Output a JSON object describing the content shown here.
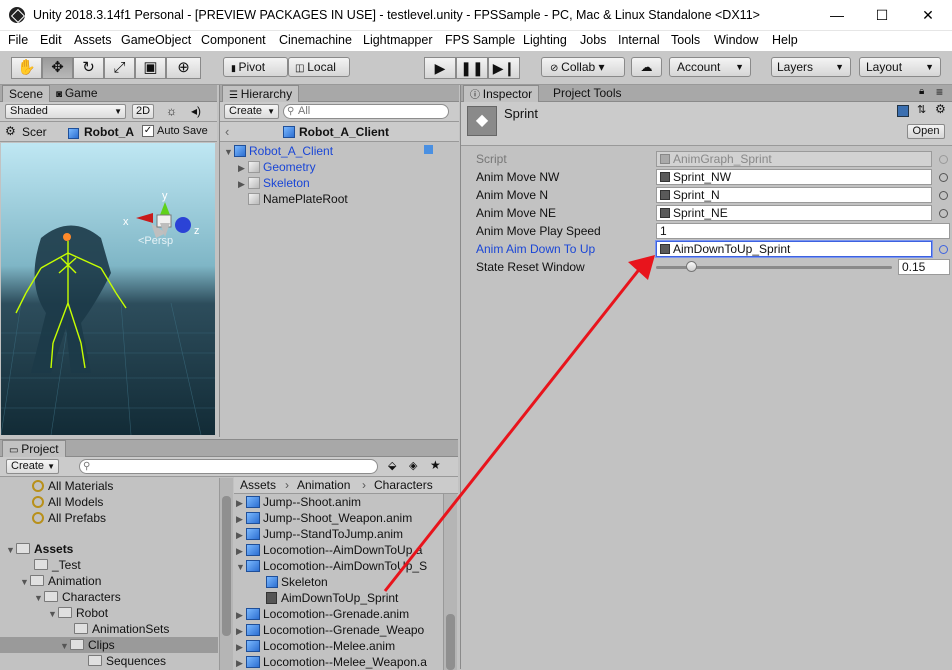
{
  "window": {
    "title": "Unity 2018.3.14f1 Personal - [PREVIEW PACKAGES IN USE] - testlevel.unity - FPSSample - PC, Mac & Linux Standalone <DX11>"
  },
  "menu": [
    "File",
    "Edit",
    "Assets",
    "GameObject",
    "Component",
    "Cinemachine",
    "Lightmapper",
    "FPS Sample",
    "Lighting",
    "Jobs",
    "Internal",
    "Tools",
    "Window",
    "Help"
  ],
  "toolbar": {
    "pivot": "Pivot",
    "local": "Local",
    "collab": "Collab ▾",
    "account": "Account",
    "layers": "Layers",
    "layout": "Layout"
  },
  "scene": {
    "tab_scene": "Scene",
    "tab_game": "Game",
    "shading": "Shaded",
    "mode_2d": "2D",
    "breadcrumb_scene": "Scer",
    "breadcrumb_object": "Robot_A",
    "auto_save": "Auto Save",
    "persp": "<Persp",
    "gizmo": {
      "y": "y",
      "x": "x",
      "z": "z"
    }
  },
  "hierarchy": {
    "tab": "Hierarchy",
    "create": "Create",
    "search_placeholder": "All",
    "header": "Robot_A_Client",
    "items": [
      {
        "label": "Robot_A_Client"
      },
      {
        "label": "Geometry"
      },
      {
        "label": "Skeleton"
      },
      {
        "label": "NamePlateRoot"
      }
    ]
  },
  "project": {
    "tab": "Project",
    "create": "Create",
    "favorites": [
      "All Materials",
      "All Models",
      "All Prefabs"
    ],
    "folders": [
      "Assets",
      "_Test",
      "Animation",
      "Characters",
      "Robot",
      "AnimationSets",
      "Clips",
      "Sequences"
    ],
    "breadcrumb": [
      "Assets",
      "Animation",
      "Characters"
    ],
    "files": [
      "Jump--Shoot.anim",
      "Jump--Shoot_Weapon.anim",
      "Jump--StandToJump.anim",
      "Locomotion--AimDownToUp.a",
      "Locomotion--AimDownToUp_S",
      "Skeleton",
      "AimDownToUp_Sprint",
      "Locomotion--Grenade.anim",
      "Locomotion--Grenade_Weapo",
      "Locomotion--Melee.anim",
      "Locomotion--Melee_Weapon.a"
    ]
  },
  "inspector": {
    "tab": "Inspector",
    "tab2": "Project Tools",
    "object_name": "Sprint",
    "open_button": "Open",
    "script_label": "Script",
    "script_value": "AnimGraph_Sprint",
    "fields": [
      {
        "label": "Anim Move NW",
        "value": "Sprint_NW"
      },
      {
        "label": "Anim Move N",
        "value": "Sprint_N"
      },
      {
        "label": "Anim Move NE",
        "value": "Sprint_NE"
      },
      {
        "label": "Anim Move Play Speed",
        "value": "1"
      },
      {
        "label": "Anim Aim Down To Up",
        "value": "AimDownToUp_Sprint"
      }
    ],
    "slider_label": "State Reset Window",
    "slider_value": "0.15",
    "slider_fraction": 0.15
  },
  "colors": {
    "accent_blue": "#1a46d6",
    "selection": "#3d7bff",
    "annotation_arrow": "#e8141c"
  }
}
